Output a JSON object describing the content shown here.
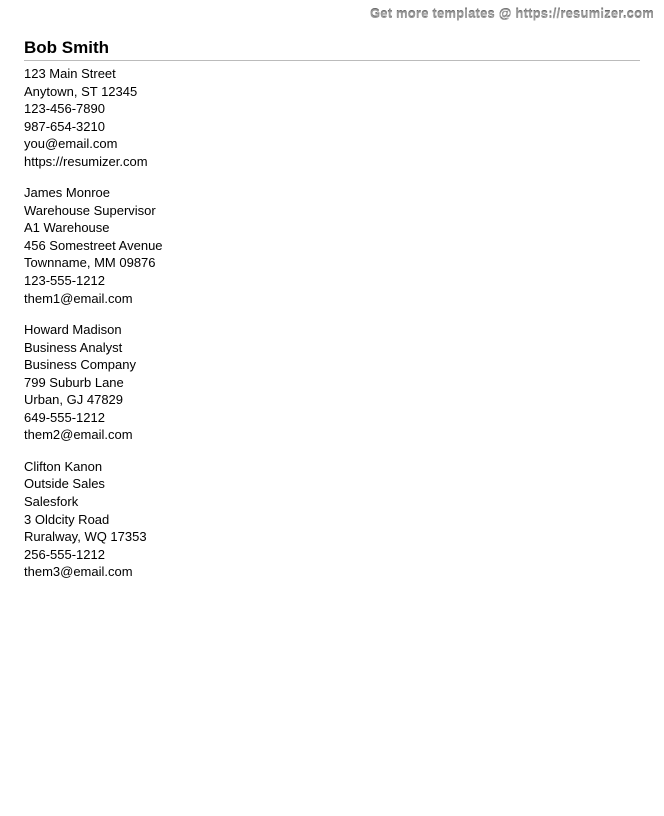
{
  "banner": "Get more templates @ https://resumizer.com",
  "applicant": {
    "name": "Bob Smith",
    "street": "123 Main Street",
    "city_state_zip": "Anytown, ST 12345",
    "phone1": "123-456-7890",
    "phone2": "987-654-3210",
    "email": "you@email.com",
    "url": "https://resumizer.com"
  },
  "references": [
    {
      "name": "James Monroe",
      "title": "Warehouse Supervisor",
      "company": "A1 Warehouse",
      "street": "456 Somestreet Avenue",
      "city_state_zip": "Townname, MM 09876",
      "phone": "123-555-1212",
      "email": "them1@email.com"
    },
    {
      "name": "Howard Madison",
      "title": "Business Analyst",
      "company": "Business Company",
      "street": "799 Suburb Lane",
      "city_state_zip": "Urban, GJ 47829",
      "phone": "649-555-1212",
      "email": "them2@email.com"
    },
    {
      "name": "Clifton Kanon",
      "title": "Outside Sales",
      "company": "Salesfork",
      "street": "3 Oldcity Road",
      "city_state_zip": "Ruralway, WQ 17353",
      "phone": "256-555-1212",
      "email": "them3@email.com"
    }
  ]
}
